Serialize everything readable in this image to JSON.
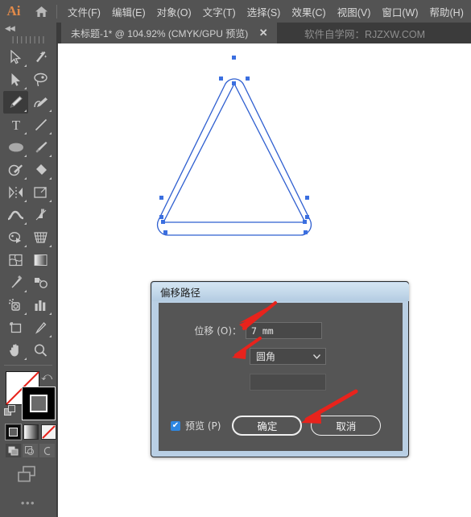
{
  "app": {
    "logo_text": "Ai",
    "home_icon": "home-icon"
  },
  "menubar": {
    "items": [
      {
        "label": "文件(F)"
      },
      {
        "label": "编辑(E)"
      },
      {
        "label": "对象(O)"
      },
      {
        "label": "文字(T)"
      },
      {
        "label": "选择(S)"
      },
      {
        "label": "效果(C)"
      },
      {
        "label": "视图(V)"
      },
      {
        "label": "窗口(W)"
      },
      {
        "label": "帮助(H)"
      }
    ]
  },
  "tabbar": {
    "document_tab": "未标题-1* @ 104.92% (CMYK/GPU 预览)",
    "close_glyph": "✕",
    "watermark": "软件自学网：RJZXW.COM"
  },
  "toolpanel": {
    "collapse_glyph": "◀◀",
    "grip_glyph": "||||||||",
    "tools": [
      {
        "name": "selection-tool",
        "selected": false,
        "has_flyout": true
      },
      {
        "name": "magic-wand-tool",
        "selected": false,
        "has_flyout": false
      },
      {
        "name": "direct-selection-tool",
        "selected": false,
        "has_flyout": true
      },
      {
        "name": "lasso-tool",
        "selected": false,
        "has_flyout": false
      },
      {
        "name": "pen-tool",
        "selected": true,
        "has_flyout": true
      },
      {
        "name": "curvature-tool",
        "selected": false,
        "has_flyout": true
      },
      {
        "name": "type-tool",
        "selected": false,
        "has_flyout": true
      },
      {
        "name": "line-segment-tool",
        "selected": false,
        "has_flyout": true
      },
      {
        "name": "ellipse-tool",
        "selected": false,
        "has_flyout": true
      },
      {
        "name": "paintbrush-tool",
        "selected": false,
        "has_flyout": true
      },
      {
        "name": "shaper-tool",
        "selected": false,
        "has_flyout": true
      },
      {
        "name": "eraser-tool",
        "selected": false,
        "has_flyout": true
      },
      {
        "name": "rotate-tool",
        "selected": false,
        "has_flyout": true
      },
      {
        "name": "scale-tool",
        "selected": false,
        "has_flyout": true
      },
      {
        "name": "width-tool",
        "selected": false,
        "has_flyout": true
      },
      {
        "name": "free-transform-tool",
        "selected": false,
        "has_flyout": false
      },
      {
        "name": "shape-builder-tool",
        "selected": false,
        "has_flyout": true
      },
      {
        "name": "perspective-grid-tool",
        "selected": false,
        "has_flyout": true
      },
      {
        "name": "mesh-tool",
        "selected": false,
        "has_flyout": false
      },
      {
        "name": "gradient-tool",
        "selected": false,
        "has_flyout": false
      },
      {
        "name": "eyedropper-tool",
        "selected": false,
        "has_flyout": true
      },
      {
        "name": "blend-tool",
        "selected": false,
        "has_flyout": false
      },
      {
        "name": "symbol-sprayer-tool",
        "selected": false,
        "has_flyout": true
      },
      {
        "name": "column-graph-tool",
        "selected": false,
        "has_flyout": true
      },
      {
        "name": "artboard-tool",
        "selected": false,
        "has_flyout": false
      },
      {
        "name": "slice-tool",
        "selected": false,
        "has_flyout": true
      },
      {
        "name": "hand-tool",
        "selected": false,
        "has_flyout": true
      },
      {
        "name": "zoom-tool",
        "selected": false,
        "has_flyout": false
      }
    ],
    "fill_color": "#ffffff",
    "stroke_color": "#000000",
    "swap_glyph": "⤺",
    "color_modes": [
      "color-swatch",
      "gradient-swatch",
      "none-swatch"
    ],
    "draw_modes": [
      "draw-normal",
      "draw-behind",
      "draw-inside"
    ],
    "more_glyph": "•••"
  },
  "artwork": {
    "shape": "offset-path-triangle",
    "path_color": "#2f5fd0",
    "anchor_color": "#3b6fe0"
  },
  "dialog": {
    "title": "偏移路径",
    "offset_label": "位移 (O)：",
    "offset_value": "7 mm",
    "join_value": "圆角",
    "join_caret": "⌄",
    "miter_value": "",
    "preview_label": "预览 (P)",
    "preview_checked": true,
    "check_glyph": "✔",
    "ok_label": "确定",
    "cancel_label": "取消",
    "title_bg": "#c3d8ea",
    "body_bg": "#555555"
  },
  "annotations": {
    "arrow_color": "#e8231c",
    "arrows": [
      {
        "name": "arrow-to-offset-input"
      },
      {
        "name": "arrow-to-join-select"
      },
      {
        "name": "arrow-to-ok-button"
      }
    ]
  }
}
